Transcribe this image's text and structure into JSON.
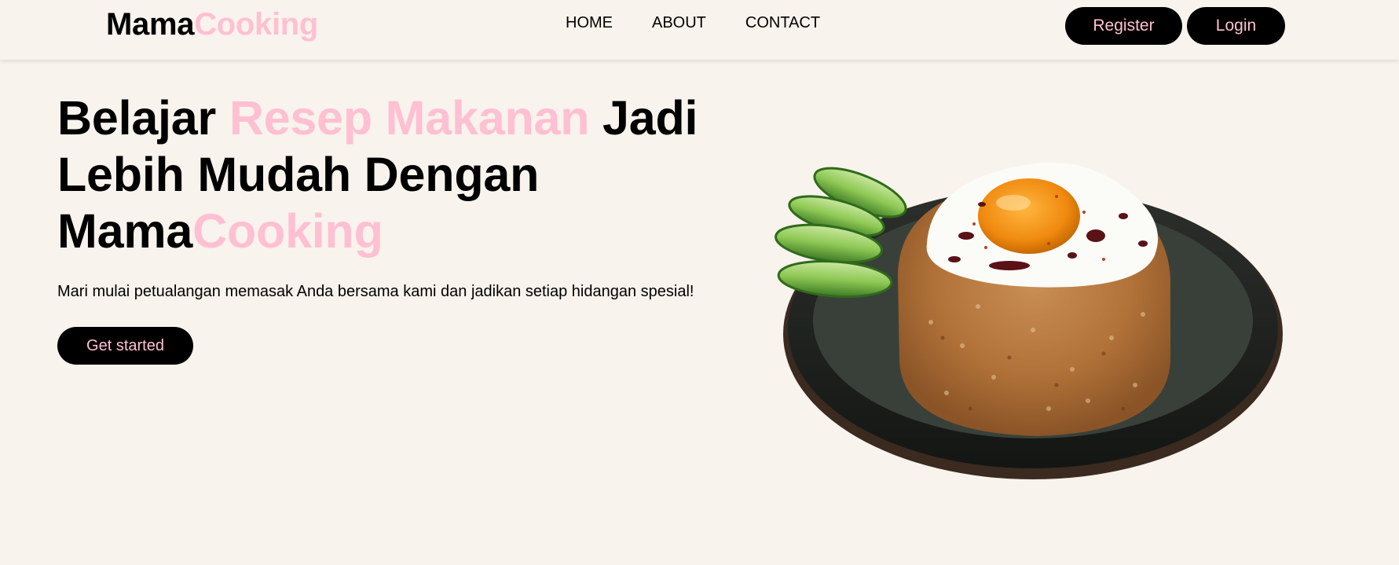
{
  "brand": {
    "part1": "Mama",
    "part2": "Cooking"
  },
  "nav": {
    "items": [
      "HOME",
      "ABOUT",
      "CONTACT"
    ]
  },
  "auth": {
    "register": "Register",
    "login": "Login"
  },
  "hero": {
    "headline_1": "Belajar ",
    "headline_2": "Resep Makanan",
    "headline_3": " Jadi Lebih Mudah Dengan ",
    "headline_4": "Mama",
    "headline_5": "Cooking",
    "subtitle": "Mari mulai petualangan memasak Anda bersama kami dan jadikan setiap hidangan spesial!",
    "cta": "Get started",
    "image_icon": "fried-rice-dish-icon"
  },
  "colors": {
    "background": "#f8f3ec",
    "accent_pink": "#ffc0d3",
    "button_bg": "#000000",
    "text": "#000000"
  }
}
